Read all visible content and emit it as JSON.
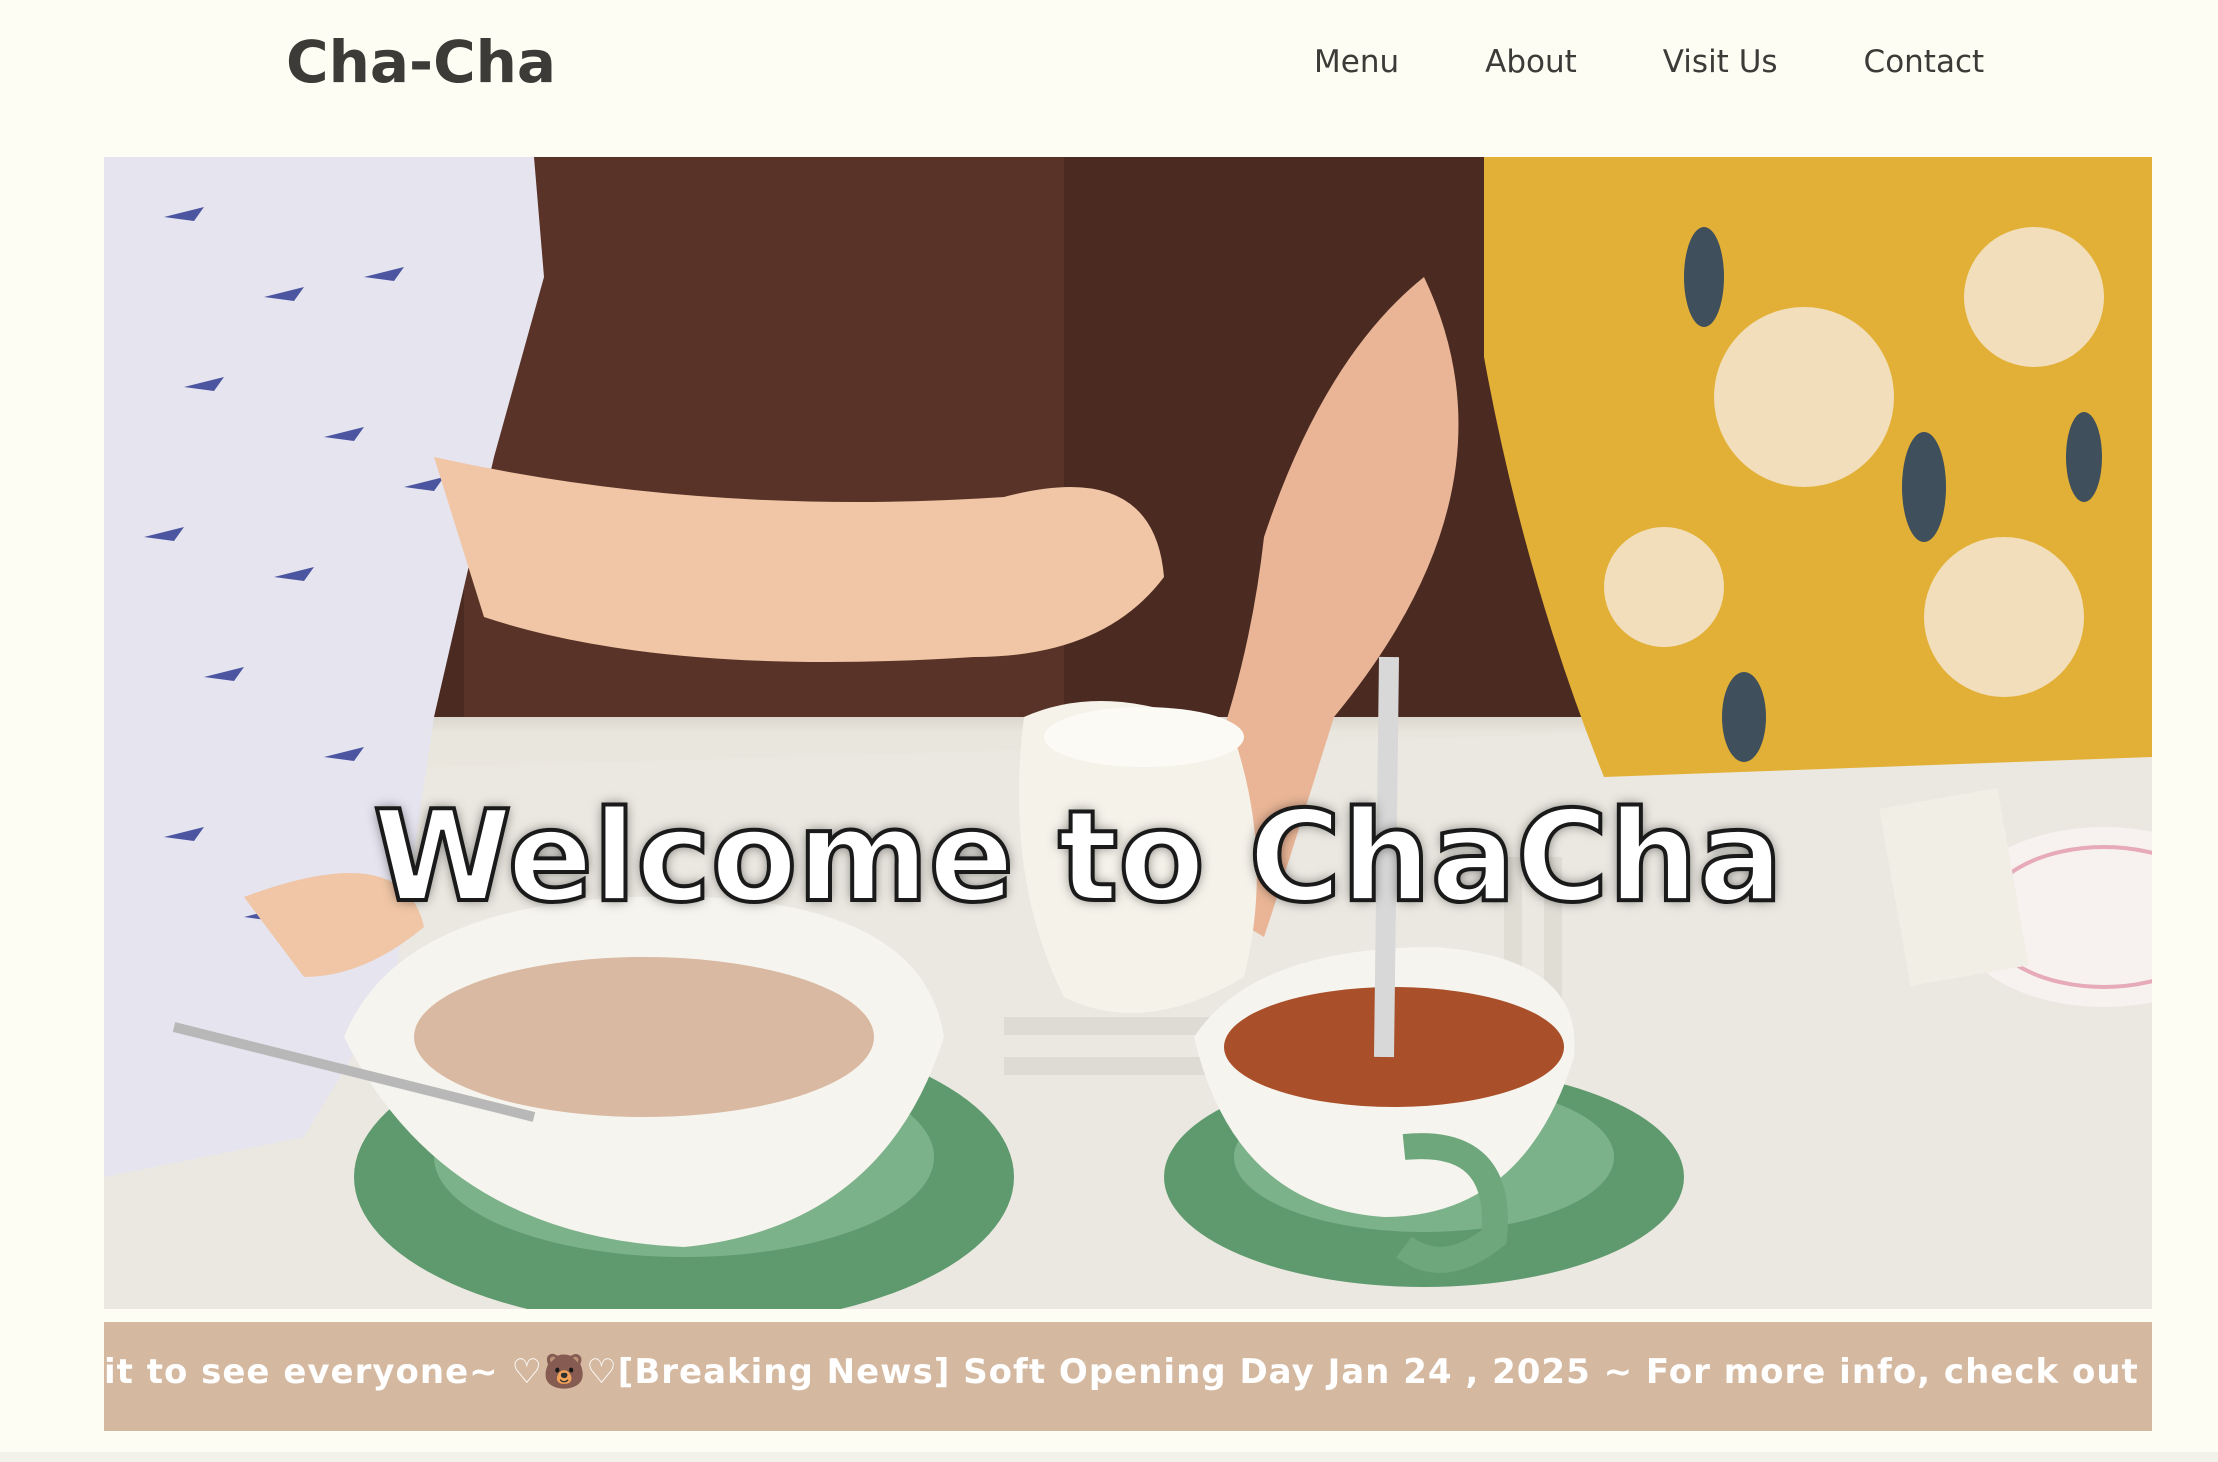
{
  "header": {
    "logo": "Cha-Cha",
    "nav": [
      "Menu",
      "About",
      "Visit Us",
      "Contact"
    ]
  },
  "hero": {
    "title": "Welcome to ChaCha",
    "image_alt_icon": "tea-party-photo"
  },
  "ticker": {
    "text": "ait to see everyone~ ♡🐻♡[Breaking News] Soft Opening Day Jan 24 , 2025 ~ For more info, check out later thi"
  },
  "colors": {
    "background": "#fefdf4",
    "ticker_bg": "#d4b8a0",
    "text": "#3d3b37"
  }
}
